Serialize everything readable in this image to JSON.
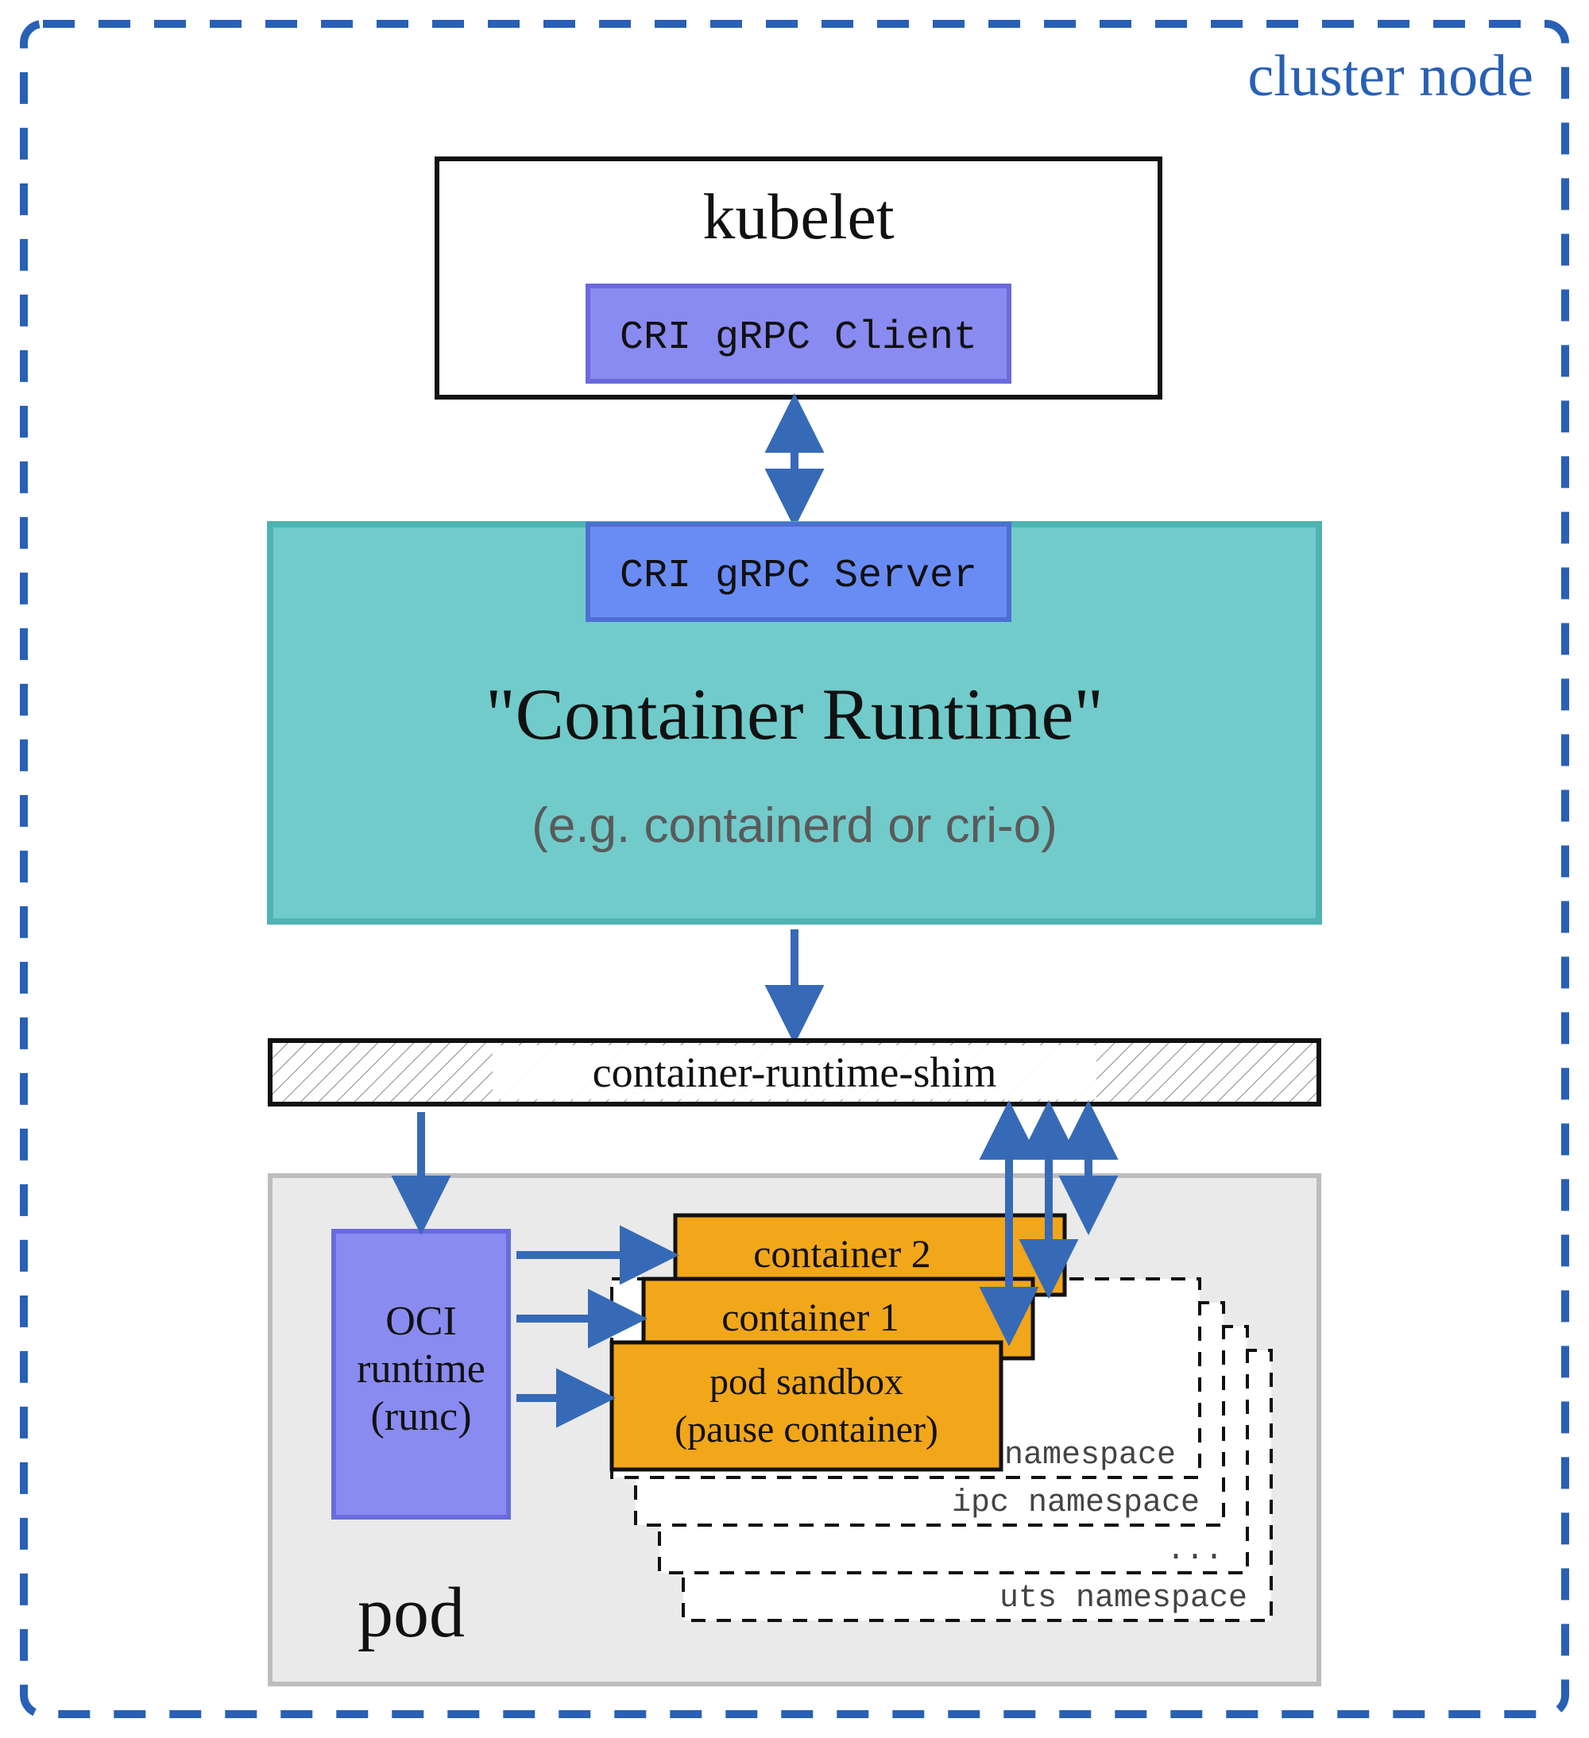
{
  "cluster_node_label": "cluster node",
  "kubelet": {
    "title": "kubelet",
    "cri_client": "CRI gRPC Client"
  },
  "container_runtime": {
    "cri_server": "CRI gRPC Server",
    "title": "\"Container Runtime\"",
    "subtitle": "(e.g. containerd or cri-o)"
  },
  "shim_label": "container-runtime-shim",
  "pod": {
    "label": "pod",
    "oci_runtime_line1": "OCI",
    "oci_runtime_line2": "runtime",
    "oci_runtime_line3": "(runc)",
    "container2": "container 2",
    "container1": "container 1",
    "sandbox_line1": "pod sandbox",
    "sandbox_line2": "(pause container)",
    "ns_net": "net namespace",
    "ns_ipc": "ipc namespace",
    "ns_dots": "...",
    "ns_uts": "uts namespace"
  },
  "colors": {
    "blue_dash": "#2860b5",
    "lilac": "#8a8bf0",
    "lilac_border": "#6a6add",
    "teal": "#71cbcb",
    "teal_border": "#4fb3b3",
    "cornflower": "#698cf4",
    "cornflower_border": "#4d6fd1",
    "orange": "#f2a619",
    "pod_bg": "#eaeaea",
    "arrow": "#366ab7"
  }
}
